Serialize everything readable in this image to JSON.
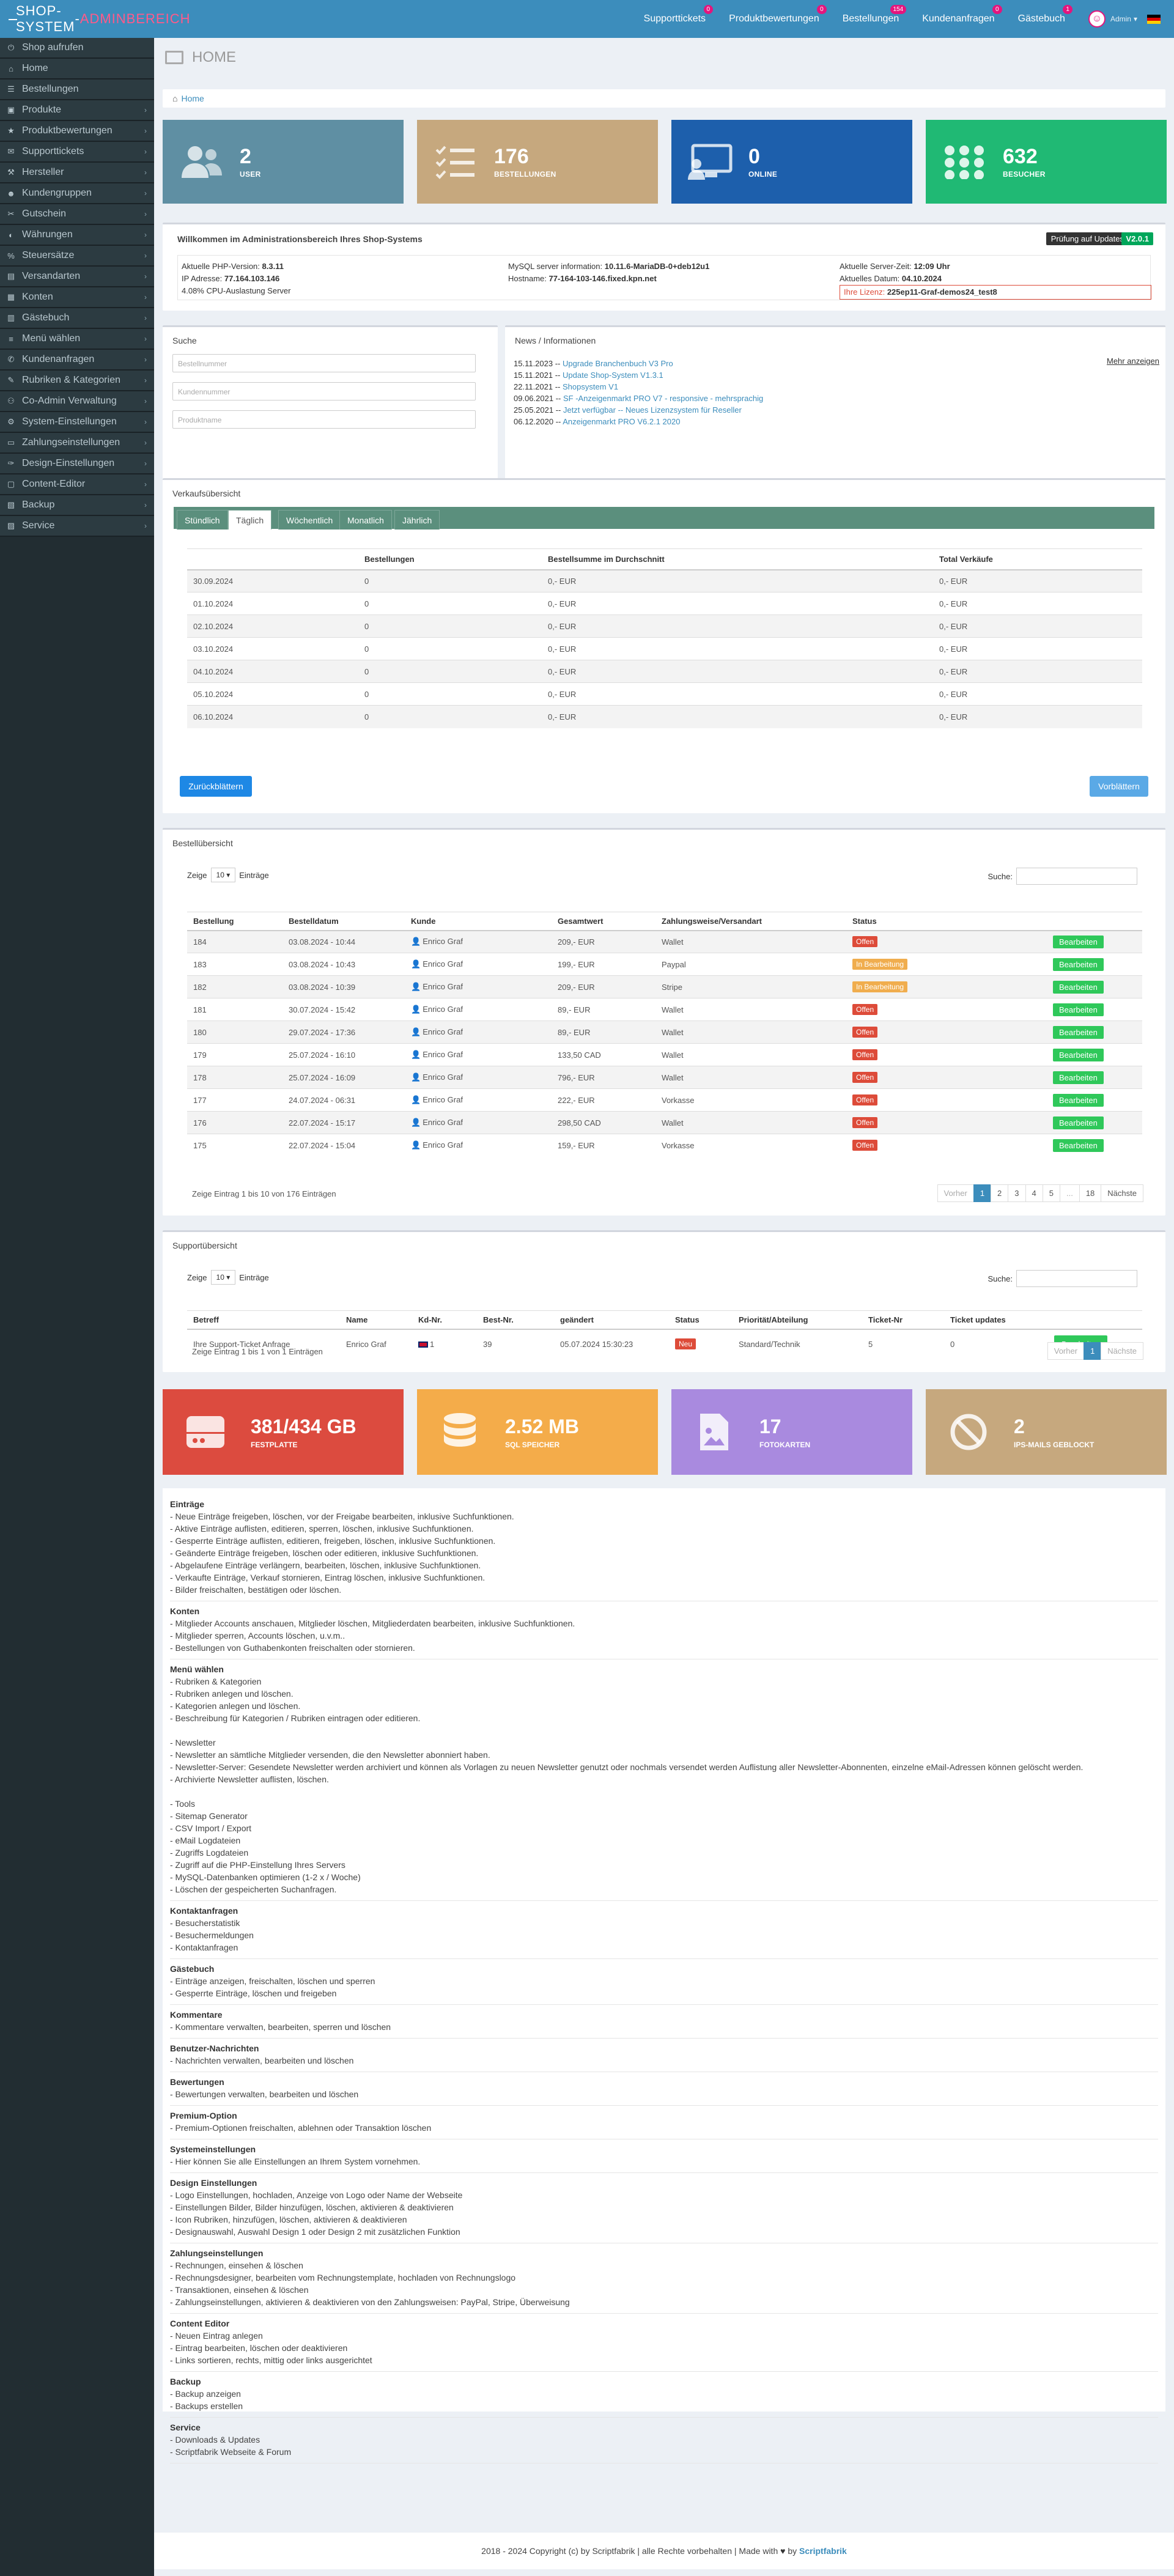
{
  "app": {
    "logo_main": "SHOP-SYSTEM",
    "logo_sep": " - ",
    "logo_accent": "ADMINBEREICH"
  },
  "topnav": [
    {
      "label": "Supporttickets",
      "badge": "0"
    },
    {
      "label": "Produktbewertungen",
      "badge": "0"
    },
    {
      "label": "Bestellungen",
      "badge": "154"
    },
    {
      "label": "Kundenanfragen",
      "badge": "0"
    },
    {
      "label": "Gästebuch",
      "badge": "1"
    }
  ],
  "user": {
    "name": "Admin",
    "arrow": "▾"
  },
  "sidebar": [
    {
      "label": "Shop aufrufen",
      "icon": "power-icon",
      "chevron": false
    },
    {
      "label": "Home",
      "icon": "home-icon",
      "chevron": false
    },
    {
      "label": "Bestellungen",
      "icon": "orders-icon",
      "chevron": false
    },
    {
      "label": "Produkte",
      "icon": "products-icon",
      "chevron": true
    },
    {
      "label": "Produktbewertungen",
      "icon": "star-icon",
      "chevron": true
    },
    {
      "label": "Supporttickets",
      "icon": "ticket-icon",
      "chevron": true
    },
    {
      "label": "Hersteller",
      "icon": "factory-icon",
      "chevron": true
    },
    {
      "label": "Kundengruppen",
      "icon": "users-icon",
      "chevron": true
    },
    {
      "label": "Gutschein",
      "icon": "voucher-icon",
      "chevron": true
    },
    {
      "label": "Währungen",
      "icon": "currency-icon",
      "chevron": true
    },
    {
      "label": "Steuersätze",
      "icon": "tax-icon",
      "chevron": true
    },
    {
      "label": "Versandarten",
      "icon": "truck-icon",
      "chevron": true
    },
    {
      "label": "Konten",
      "icon": "accounts-icon",
      "chevron": true
    },
    {
      "label": "Gästebuch",
      "icon": "guestbook-icon",
      "chevron": true
    },
    {
      "label": "Menü wählen",
      "icon": "menu-icon",
      "chevron": true
    },
    {
      "label": "Kundenanfragen",
      "icon": "inquiry-icon",
      "chevron": true
    },
    {
      "label": "Rubriken & Kategorien",
      "icon": "category-icon",
      "chevron": true
    },
    {
      "label": "Co-Admin Verwaltung",
      "icon": "coadmin-icon",
      "chevron": true
    },
    {
      "label": "System-Einstellungen",
      "icon": "system-icon",
      "chevron": true
    },
    {
      "label": "Zahlungseinstellungen",
      "icon": "payment-icon",
      "chevron": true
    },
    {
      "label": "Design-Einstellungen",
      "icon": "design-icon",
      "chevron": true
    },
    {
      "label": "Content-Editor",
      "icon": "editor-icon",
      "chevron": true
    },
    {
      "label": "Backup",
      "icon": "backup-icon",
      "chevron": true
    },
    {
      "label": "Service",
      "icon": "service-icon",
      "chevron": true
    }
  ],
  "page": {
    "title": "HOME",
    "breadcrumb": "Home"
  },
  "stats": [
    {
      "num": "2",
      "label": "USER",
      "color": "#5f8fa3",
      "icon": "users-icon"
    },
    {
      "num": "176",
      "label": "BESTELLUNGEN",
      "color": "#c6a87e",
      "icon": "list-check-icon"
    },
    {
      "num": "0",
      "label": "ONLINE",
      "color": "#1d5fac",
      "icon": "monitor-user-icon"
    },
    {
      "num": "632",
      "label": "BESUCHER",
      "color": "#20b974",
      "icon": "grid-dots-icon"
    }
  ],
  "welcome": {
    "title": "Willkommen im Administrationsbereich Ihres Shop-Systems",
    "update_btn": "Prüfung auf Updates",
    "version": "V2.0.1",
    "col1": [
      [
        "Aktuelle PHP-Version: ",
        "8.3.11"
      ],
      [
        "IP Adresse: ",
        "77.164.103.146"
      ],
      [
        "4.08% CPU-Auslastung Server",
        ""
      ]
    ],
    "col2": [
      [
        "MySQL server information: ",
        "10.11.6-MariaDB-0+deb12u1"
      ],
      [
        "Hostname: ",
        "77-164-103-146.fixed.kpn.net"
      ]
    ],
    "col3": [
      [
        "Aktuelle Server-Zeit: ",
        "12:09 Uhr"
      ],
      [
        "Aktuelles Datum: ",
        "04.10.2024"
      ]
    ],
    "license_label": "Ihre Lizenz: ",
    "license": "225ep11-Graf-demos24_test8"
  },
  "search": {
    "title": "Suche",
    "fields": [
      "Bestellnummer",
      "Kundennummer",
      "Produktname"
    ]
  },
  "news": {
    "title": "News / Informationen",
    "more": "Mehr anzeigen",
    "items": [
      {
        "date": "15.11.2023",
        "text": "Upgrade Branchenbuch V3 Pro"
      },
      {
        "date": "15.11.2021",
        "text": "Update Shop-System V1.3.1"
      },
      {
        "date": "22.11.2021",
        "text": "Shopsystem V1"
      },
      {
        "date": "09.06.2021",
        "text": "SF -Anzeigenmarkt PRO V7 - responsive - mehrsprachig"
      },
      {
        "date": "25.05.2021",
        "text": "Jetzt verfügbar -- Neues Lizenzsystem für Reseller"
      },
      {
        "date": "06.12.2020",
        "text": "Anzeigenmarkt PRO V6.2.1 2020"
      }
    ]
  },
  "sales": {
    "title": "Verkaufsübersicht",
    "tabs": [
      "Stündlich",
      "Täglich",
      "Wöchentlich",
      "Monatlich",
      "Jährlich"
    ],
    "active_tab": 1,
    "headers": [
      "",
      "Bestellungen",
      "Bestellsumme im Durchschnitt",
      "Total Verkäufe"
    ],
    "rows": [
      [
        "30.09.2024",
        "0",
        "0,- EUR",
        "0,- EUR"
      ],
      [
        "01.10.2024",
        "0",
        "0,- EUR",
        "0,- EUR"
      ],
      [
        "02.10.2024",
        "0",
        "0,- EUR",
        "0,- EUR"
      ],
      [
        "03.10.2024",
        "0",
        "0,- EUR",
        "0,- EUR"
      ],
      [
        "04.10.2024",
        "0",
        "0,- EUR",
        "0,- EUR"
      ],
      [
        "05.10.2024",
        "0",
        "0,- EUR",
        "0,- EUR"
      ],
      [
        "06.10.2024",
        "0",
        "0,- EUR",
        "0,- EUR"
      ]
    ],
    "prev": "Zurückblättern",
    "next": "Vorblättern"
  },
  "orders": {
    "title": "Bestellübersicht",
    "show": "Zeige",
    "count": "10",
    "entries": "Einträge",
    "search": "Suche:",
    "headers": [
      "Bestellung",
      "Bestelldatum",
      "Kunde",
      "Gesamtwert",
      "Zahlungsweise/Versandart",
      "Status",
      ""
    ],
    "rows": [
      [
        "184",
        "03.08.2024 - 10:44",
        "Enrico Graf",
        "209,- EUR",
        "Wallet",
        "Offen"
      ],
      [
        "183",
        "03.08.2024 - 10:43",
        "Enrico Graf",
        "199,- EUR",
        "Paypal",
        "In Bearbeitung"
      ],
      [
        "182",
        "03.08.2024 - 10:39",
        "Enrico Graf",
        "209,- EUR",
        "Stripe",
        "In Bearbeitung"
      ],
      [
        "181",
        "30.07.2024 - 15:42",
        "Enrico Graf",
        "89,- EUR",
        "Wallet",
        "Offen"
      ],
      [
        "180",
        "29.07.2024 - 17:36",
        "Enrico Graf",
        "89,- EUR",
        "Wallet",
        "Offen"
      ],
      [
        "179",
        "25.07.2024 - 16:10",
        "Enrico Graf",
        "133,50 CAD",
        "Wallet",
        "Offen"
      ],
      [
        "178",
        "25.07.2024 - 16:09",
        "Enrico Graf",
        "796,- EUR",
        "Wallet",
        "Offen"
      ],
      [
        "177",
        "24.07.2024 - 06:31",
        "Enrico Graf",
        "222,- EUR",
        "Vorkasse",
        "Offen"
      ],
      [
        "176",
        "22.07.2024 - 15:17",
        "Enrico Graf",
        "298,50 CAD",
        "Wallet",
        "Offen"
      ],
      [
        "175",
        "22.07.2024 - 15:04",
        "Enrico Graf",
        "159,- EUR",
        "Vorkasse",
        "Offen"
      ]
    ],
    "edit": "Bearbeiten",
    "info": "Zeige Eintrag 1 bis 10 von 176 Einträgen",
    "pager": [
      "Vorher",
      "1",
      "2",
      "3",
      "4",
      "5",
      "...",
      "18",
      "Nächste"
    ]
  },
  "support": {
    "title": "Supportübersicht",
    "show": "Zeige",
    "count": "10",
    "entries": "Einträge",
    "search": "Suche:",
    "headers": [
      "Betreff",
      "Name",
      "Kd-Nr.",
      "Best-Nr.",
      "geändert",
      "Status",
      "Priorität/Abteilung",
      "Ticket-Nr",
      "Ticket updates",
      ""
    ],
    "row": [
      "Ihre Support-Ticket Anfrage",
      "Enrico Graf",
      "1",
      "39",
      "05.07.2024 15:30:23",
      "Neu",
      "Standard/Technik",
      "5",
      "0"
    ],
    "edit": "Bearbeiten",
    "info": "Zeige Eintrag 1 bis 1 von 1 Einträgen",
    "pager": [
      "Vorher",
      "1",
      "Nächste"
    ]
  },
  "capacity": [
    {
      "num": "381/434 GB",
      "label": "FESTPLATTE",
      "color": "#dc4b3f",
      "icon": "harddisk-icon"
    },
    {
      "num": "2.52 MB",
      "label": "SQL SPEICHER",
      "color": "#f4ac4a",
      "icon": "database-icon"
    },
    {
      "num": "17",
      "label": "FOTOKARTEN",
      "color": "#a98adf",
      "icon": "image-file-icon"
    },
    {
      "num": "2",
      "label": "IPS-MAILS GEBLOCKT",
      "color": "#c6a87e",
      "icon": "ban-icon"
    }
  ],
  "help": [
    {
      "title": "Einträge",
      "lines": [
        "- Neue Einträge freigeben, löschen, vor der Freigabe bearbeiten, inklusive Suchfunktionen.",
        "- Aktive Einträge auflisten, editieren, sperren, löschen, inklusive Suchfunktionen.",
        "- Gesperrte Einträge auflisten, editieren, freigeben, löschen, inklusive Suchfunktionen.",
        "- Geänderte Einträge freigeben, löschen oder editieren, inklusive Suchfunktionen.",
        "- Abgelaufene Einträge verlängern, bearbeiten, löschen, inklusive Suchfunktionen.",
        "- Verkaufte Einträge, Verkauf stornieren, Eintrag löschen, inklusive Suchfunktionen.",
        "- Bilder freischalten, bestätigen oder löschen."
      ]
    },
    {
      "title": "Konten",
      "lines": [
        "- Mitglieder Accounts anschauen, Mitglieder löschen, Mitgliederdaten bearbeiten, inklusive Suchfunktionen.",
        "- Mitglieder sperren, Accounts löschen, u.v.m..",
        "- Bestellungen von Guthabenkonten freischalten oder stornieren."
      ]
    },
    {
      "title": "Menü wählen",
      "lines": [
        "- Rubriken & Kategorien",
        "- Rubriken anlegen und löschen.",
        "- Kategorien anlegen und löschen.",
        "- Beschreibung für Kategorien / Rubriken eintragen oder editieren.",
        "",
        "- Newsletter",
        "- Newsletter an sämtliche Mitglieder versenden, die den Newsletter abonniert haben.",
        "- Newsletter-Server: Gesendete Newsletter werden archiviert und können als Vorlagen zu neuen Newsletter genutzt oder nochmals versendet werden Auflistung aller Newsletter-Abonnenten, einzelne eMail-Adressen können gelöscht werden.",
        "- Archivierte Newsletter auflisten, löschen.",
        "",
        "- Tools",
        "- Sitemap Generator",
        "- CSV Import / Export",
        "- eMail Logdateien",
        "- Zugriffs Logdateien",
        "- Zugriff auf die PHP-Einstellung Ihres Servers",
        "- MySQL-Datenbanken optimieren (1-2 x / Woche)",
        "- Löschen der gespeicherten Suchanfragen."
      ]
    },
    {
      "title": "Kontaktanfragen",
      "lines": [
        "- Besucherstatistik",
        "- Besuchermeldungen",
        "- Kontaktanfragen"
      ]
    },
    {
      "title": "Gästebuch",
      "lines": [
        "- Einträge anzeigen, freischalten, löschen und sperren",
        "- Gesperrte Einträge, löschen und freigeben"
      ]
    },
    {
      "title": "Kommentare",
      "lines": [
        "- Kommentare verwalten, bearbeiten, sperren und löschen"
      ]
    },
    {
      "title": "Benutzer-Nachrichten",
      "lines": [
        "- Nachrichten verwalten, bearbeiten und löschen"
      ]
    },
    {
      "title": "Bewertungen",
      "lines": [
        "- Bewertungen verwalten, bearbeiten und löschen"
      ]
    },
    {
      "title": "Premium-Option",
      "lines": [
        "- Premium-Optionen freischalten, ablehnen oder Transaktion löschen"
      ]
    },
    {
      "title": "Systemeinstellungen",
      "lines": [
        "- Hier können Sie alle Einstellungen an Ihrem System vornehmen."
      ]
    },
    {
      "title": "Design Einstellungen",
      "lines": [
        "- Logo Einstellungen, hochladen, Anzeige von Logo oder Name der Webseite",
        "- Einstellungen Bilder, Bilder hinzufügen, löschen, aktivieren & deaktivieren",
        "- Icon Rubriken, hinzufügen, löschen, aktivieren & deaktivieren",
        "- Designauswahl, Auswahl Design 1 oder Design 2 mit zusätzlichen Funktion"
      ]
    },
    {
      "title": "Zahlungseinstellungen",
      "lines": [
        "- Rechnungen, einsehen & löschen",
        "- Rechnungsdesigner, bearbeiten vom Rechnungstemplate, hochladen von Rechnungslogo",
        "- Transaktionen, einsehen & löschen",
        "- Zahlungseinstellungen, aktivieren & deaktivieren von den Zahlungsweisen: PayPal, Stripe, Überweisung"
      ]
    },
    {
      "title": "Content Editor",
      "lines": [
        "- Neuen Eintrag anlegen",
        "- Eintrag bearbeiten, löschen oder deaktivieren",
        "- Links sortieren, rechts, mittig oder links ausgerichtet"
      ]
    },
    {
      "title": "Backup",
      "lines": [
        "- Backup anzeigen",
        "- Backups erstellen"
      ]
    },
    {
      "title": "Service",
      "lines": [
        "- Downloads & Updates",
        "- Scriptfabrik Webseite & Forum"
      ]
    }
  ],
  "footer": {
    "text": "2018 - 2024 Copyright (c) by Scriptfabrik | alle Rechte vorbehalten | Made with",
    "heart": "♥",
    "by": " by ",
    "brand": "Scriptfabrik"
  }
}
